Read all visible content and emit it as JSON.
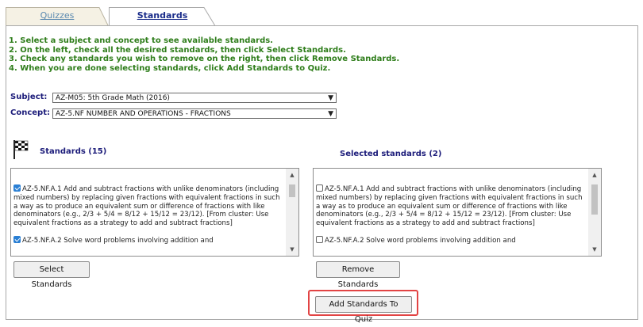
{
  "tabs": [
    {
      "label": "Quizzes",
      "active": false
    },
    {
      "label": "Standards",
      "active": true
    }
  ],
  "instructions": [
    "1. Select a subject and concept to see available standards.",
    "2. On the left, check all the desired standards, then click Select Standards.",
    "3. Check any standards you wish to remove on the right, then click Remove Standards.",
    "4. When you are done selecting standards, click Add Standards to Quiz."
  ],
  "subject": {
    "label": "Subject:",
    "value": "AZ-M05: 5th Grade Math (2016)"
  },
  "concept": {
    "label": "Concept:",
    "value": "AZ-5.NF NUMBER AND OPERATIONS - FRACTIONS"
  },
  "left_panel": {
    "icon": "checkered-flag-icon",
    "heading": "Standards (15)",
    "items": [
      {
        "checked": true,
        "text": "AZ-5.NF.A.1 Add and subtract fractions with unlike denominators (including mixed numbers) by replacing given fractions with equivalent fractions in such a way as to produce an equivalent sum or difference of fractions with like denominators (e.g., 2/3 + 5/4 = 8/12 + 15/12 = 23/12). [From cluster: Use equivalent fractions as a strategy to add and subtract fractions]"
      },
      {
        "checked": true,
        "text": "AZ-5.NF.A.2 Solve word problems involving addition and"
      }
    ],
    "button": "Select Standards"
  },
  "right_panel": {
    "heading": "Selected standards (2)",
    "items": [
      {
        "checked": false,
        "text": "AZ-5.NF.A.1 Add and subtract fractions with unlike denominators (including mixed numbers) by replacing given fractions with equivalent fractions in such a way as to produce an equivalent sum or difference of fractions with like denominators (e.g., 2/3 + 5/4 = 8/12 + 15/12 = 23/12). [From cluster: Use equivalent fractions as a strategy to add and subtract fractions]"
      },
      {
        "checked": false,
        "text": "AZ-5.NF.A.2 Solve word problems involving addition and"
      }
    ],
    "button": "Remove Standards"
  },
  "add_button": "Add Standards To Quiz",
  "colors": {
    "instructions": "#2e7d1a",
    "labels": "#1c1c7a",
    "highlight": "#e24444",
    "checkbox": "#2a7fd4"
  }
}
